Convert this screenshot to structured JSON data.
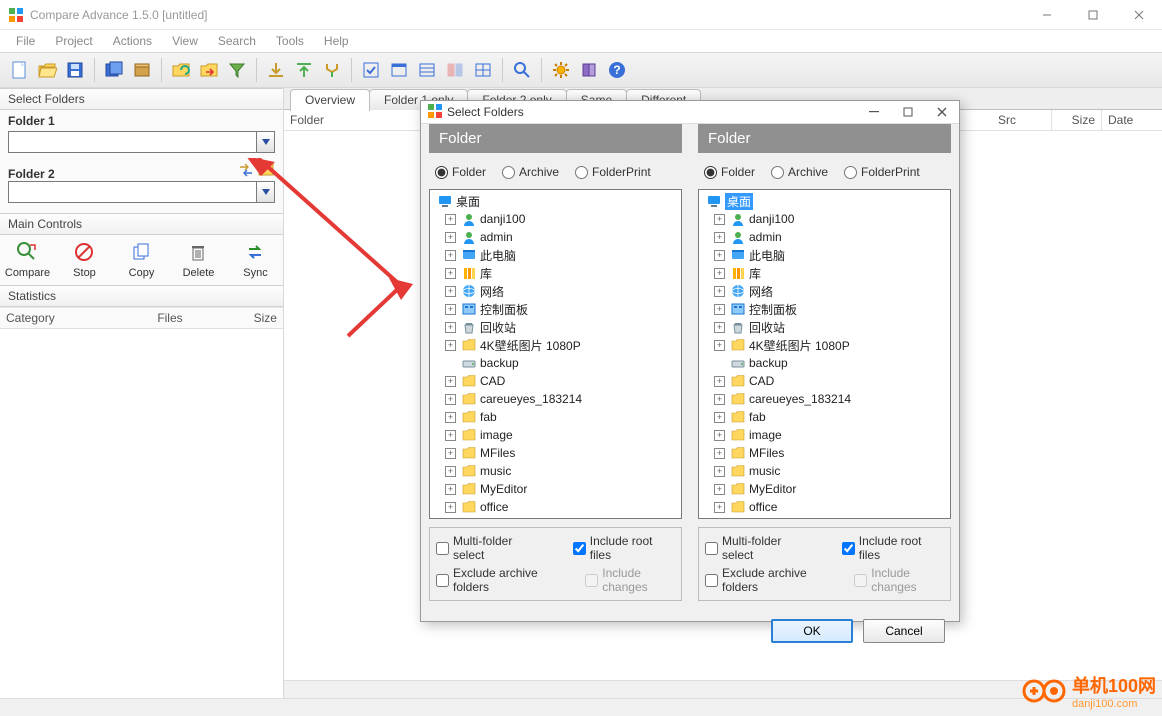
{
  "window": {
    "title": "Compare Advance 1.5.0 [untitled]"
  },
  "menu": [
    "File",
    "Project",
    "Actions",
    "View",
    "Search",
    "Tools",
    "Help"
  ],
  "left": {
    "panel1": "Select Folders",
    "folder1": "Folder 1",
    "folder2": "Folder 2",
    "panel2": "Main Controls",
    "controls": [
      {
        "id": "compare",
        "label": "Compare"
      },
      {
        "id": "stop",
        "label": "Stop"
      },
      {
        "id": "copy",
        "label": "Copy"
      },
      {
        "id": "delete",
        "label": "Delete"
      },
      {
        "id": "sync",
        "label": "Sync"
      }
    ],
    "panel3": "Statistics",
    "stat_cols": [
      "Category",
      "Files",
      "Size"
    ]
  },
  "tabs": [
    "Overview",
    "Folder 1 only",
    "Folder 2 only",
    "Same",
    "Different"
  ],
  "content_cols": [
    "Folder",
    "Src",
    "Size",
    "Date"
  ],
  "dialog": {
    "title": "Select Folders",
    "header": "Folder",
    "radios": [
      "Folder",
      "Archive",
      "FolderPrint"
    ],
    "tree": [
      {
        "icon": "desktop",
        "label": "桌面",
        "depth": 0,
        "sel_right": true,
        "top": true
      },
      {
        "icon": "user",
        "label": "danji100",
        "depth": 1,
        "tw": "+"
      },
      {
        "icon": "user",
        "label": "admin",
        "depth": 1,
        "tw": "+"
      },
      {
        "icon": "pc",
        "label": "此电脑",
        "depth": 1,
        "tw": "+"
      },
      {
        "icon": "lib",
        "label": "库",
        "depth": 1,
        "tw": "+"
      },
      {
        "icon": "net",
        "label": "网络",
        "depth": 1,
        "tw": "+"
      },
      {
        "icon": "ctrl",
        "label": "控制面板",
        "depth": 1,
        "tw": "+"
      },
      {
        "icon": "recy",
        "label": "回收站",
        "depth": 1,
        "tw": "+"
      },
      {
        "icon": "folder",
        "label": "4K壁纸图片 1080P",
        "depth": 1,
        "tw": "+"
      },
      {
        "icon": "drive",
        "label": "backup",
        "depth": 1,
        "tw": ""
      },
      {
        "icon": "folder",
        "label": "CAD",
        "depth": 1,
        "tw": "+"
      },
      {
        "icon": "folder",
        "label": "careueyes_183214",
        "depth": 1,
        "tw": "+"
      },
      {
        "icon": "folder",
        "label": "fab",
        "depth": 1,
        "tw": "+"
      },
      {
        "icon": "folder",
        "label": "image",
        "depth": 1,
        "tw": "+"
      },
      {
        "icon": "folder",
        "label": "MFiles",
        "depth": 1,
        "tw": "+"
      },
      {
        "icon": "folder",
        "label": "music",
        "depth": 1,
        "tw": "+"
      },
      {
        "icon": "folder",
        "label": "MyEditor",
        "depth": 1,
        "tw": "+"
      },
      {
        "icon": "folder",
        "label": "office",
        "depth": 1,
        "tw": "+"
      }
    ],
    "checks": {
      "multi": "Multi-folder select",
      "root": "Include root files",
      "excl": "Exclude archive folders",
      "incl": "Include changes"
    },
    "ok": "OK",
    "cancel": "Cancel"
  },
  "watermark": {
    "big": "单机100网",
    "small": "danji100.com"
  }
}
